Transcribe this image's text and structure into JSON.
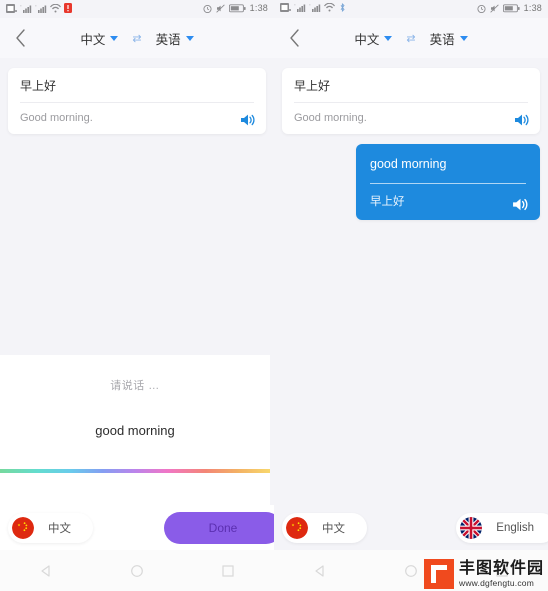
{
  "statusbar": {
    "left_icons": [
      "sim-card-icon",
      "signal-bars-icon",
      "signal-bars-2-icon",
      "wifi-icon",
      "battery-alert-icon"
    ],
    "left_icons_right_panel": [
      "sim-card-icon",
      "signal-bars-icon",
      "signal-bars-2-icon",
      "wifi-icon",
      "bluetooth-icon"
    ],
    "right_icons": [
      "alarm-icon",
      "mute-icon",
      "battery-icon"
    ],
    "time": "1:38"
  },
  "header": {
    "back_label": "‹",
    "source_lang": "中文",
    "swap_icon": "⇄",
    "target_lang": "英语"
  },
  "left_panel": {
    "card": {
      "source_text": "早上好",
      "translated_text": "Good morning.",
      "speaker_icon": "speaker-icon"
    },
    "voice_sheet": {
      "hint": "请说话 …",
      "recognized_text": "good morning"
    },
    "bottom": {
      "lang_pill_label": "中文",
      "lang_pill_flag": "china-flag-icon",
      "done_label": "Done"
    }
  },
  "right_panel": {
    "cards": [
      {
        "style": "white",
        "source_text": "早上好",
        "translated_text": "Good morning.",
        "speaker_icon": "speaker-icon"
      },
      {
        "style": "blue",
        "source_text": "good morning",
        "translated_text": "早上好",
        "speaker_icon": "speaker-icon"
      }
    ],
    "bottom": {
      "left_pill_label": "中文",
      "left_pill_flag": "china-flag-icon",
      "right_pill_label": "English",
      "right_pill_flag": "uk-flag-icon"
    }
  },
  "navbar": {
    "back_icon": "nav-back-triangle-icon",
    "home_icon": "nav-home-circle-icon",
    "recents_icon": "nav-recents-square-icon"
  },
  "watermark": {
    "name": "丰图软件园",
    "url": "www.dgfengtu.com"
  },
  "colors": {
    "accent_blue": "#1e8ade",
    "caret_blue": "#2d8cf0",
    "done_purple": "#8a5ce8",
    "background": "#f4f4f8",
    "watermark_orange": "#f04a1e"
  }
}
